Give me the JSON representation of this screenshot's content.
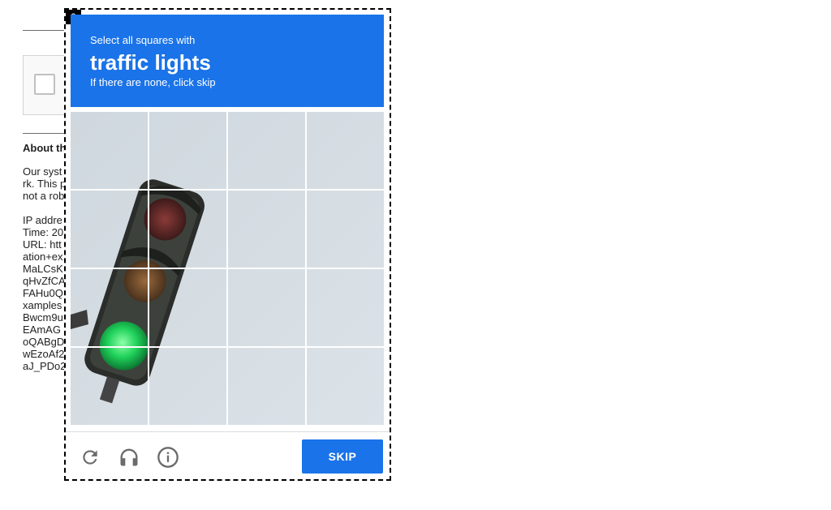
{
  "background_page": {
    "about_title": "About th",
    "lines": [
      "Our syst",
      "rk. This p",
      "not a rob",
      "",
      "IP addre",
      "Time: 20",
      "URL: htt",
      "ation+ex",
      "MaLCsK",
      "qHvZfCA",
      "FAHu0Q",
      "xamples",
      "Bwcm9u",
      "EAmAG",
      "oQABgD",
      "wEzoAf2",
      "aJ_PDo2"
    ]
  },
  "challenge": {
    "frame_index": "0",
    "instruction_prefix": "Select all squares with",
    "target": "traffic lights",
    "hint": "If there are none, click skip",
    "grid_rows": 4,
    "grid_cols": 4,
    "image_subject": "traffic light with green light lit against overcast sky",
    "skip_label": "SKIP",
    "icons": [
      "reload-icon",
      "audio-headphones-icon",
      "info-icon"
    ],
    "colors": {
      "header": "#1a73e8",
      "button": "#1a73e8",
      "sky": "#d5dde4"
    }
  }
}
